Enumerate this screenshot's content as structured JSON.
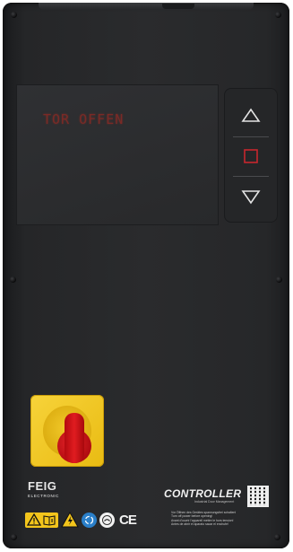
{
  "display": {
    "status_text": "TOR OFFEN"
  },
  "keypad": {
    "up_icon": "triangle-up-outline",
    "stop_icon": "square-outline",
    "down_icon": "triangle-down-outline",
    "stop_color": "#c6272e",
    "icon_color": "#e4e4e4"
  },
  "main_switch": {
    "plate_color": "#f2c31a",
    "knob_color": "#d2161b"
  },
  "branding": {
    "manufacturer": "FEIG",
    "manufacturer_sub": "ELECTRONIC",
    "product": "CONTROLLER",
    "product_sub": "Industrial Door Management"
  },
  "labels": {
    "warning_text": [
      "Vor Öffnen des Gerätes spannungsfrei schalten!",
      "Turn off power before opening!",
      "Avant d'ouvrir l'appareil mettre le hors tension!",
      "Antes de abrir el aparato sacar el enchufe!"
    ],
    "certification": "CE",
    "icons": [
      "warning-manual-icon",
      "electrical-hazard-icon",
      "recycling-icon",
      "disposal-icon"
    ]
  }
}
